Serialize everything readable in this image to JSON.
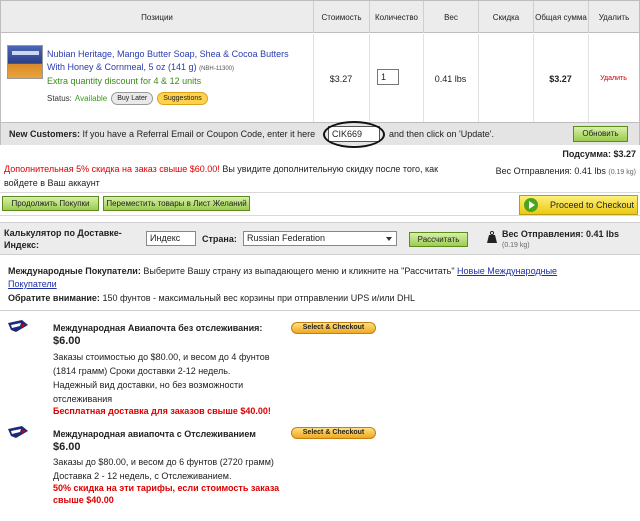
{
  "table": {
    "headers": [
      "Позиции",
      "Стоимость",
      "Количество",
      "Вес",
      "Скидка",
      "Общая сумма",
      "Удалить"
    ],
    "item": {
      "name": "Nubian Heritage, Mango Butter Soap, Shea & Cocoa Butters With Honey & Cornmeal, 5 oz (141 g)",
      "code": "(NBH-11300)",
      "discount": "Extra quantity discount for 4 & 12 units",
      "status_label": "Status:",
      "status_value": "Available",
      "buy_later": "Buy Later",
      "suggestions": "Suggestions",
      "price": "$3.27",
      "quantity": "1",
      "weight": "0.41 lbs",
      "total": "$3.27",
      "remove": "Удалить"
    }
  },
  "coupon": {
    "label_bold": "New Customers:",
    "label_text": "If you have a Referral Email or Coupon Code, enter it here",
    "value": "CIK669",
    "after_text": "and then click on 'Update'.",
    "update_button": "Обновить"
  },
  "promo": {
    "red_text": "Дополнительная 5% скидка на заказ свыше $60.00!",
    "text": "Вы увидите дополнительную скидку после того, как войдете в Ваш аккаунт"
  },
  "summary": {
    "subtotal_label": "Подсумма:",
    "subtotal_value": "$3.27",
    "shipping_weight_label": "Вес Отправления:",
    "shipping_weight_value": "0.41 lbs",
    "shipping_weight_kg": "(0.19 kg)"
  },
  "actions": {
    "continue_shopping": "Продолжить Покупки",
    "move_to_wishlist": "Переместить товары в Лист Желаний",
    "proceed_checkout": "Proceed to Checkout"
  },
  "calculator": {
    "label": "Калькулятор по Доставке- Индекс:",
    "zip_value": "Индекс",
    "country_label": "Страна:",
    "country_value": "Russian Federation",
    "calculate_button": "Рассчитать",
    "weight_label": "Вес Отправления:",
    "weight_value": "0.41 lbs",
    "weight_kg": "(0.19 kg)"
  },
  "international": {
    "bold": "Международные Покупатели:",
    "text": "Выберите Вашу страну из выпадающего меню и кликните на \"Рассчитать\"",
    "link": "Новые Международные Покупатели",
    "note_bold": "Обратите внимание:",
    "note_text": "150 фунтов - максимальный вес корзины при отправлении UPS и/или DHL"
  },
  "shipping_options": [
    {
      "title": "Международная Авиапочта без отслеживания:",
      "price": "$6.00",
      "desc_lines": [
        "Заказы стоимостью до $80.00, и весом до 4 фунтов",
        "(1814 грамм) Сроки доставки 2-12 недель.",
        "Надежный вид доставки, но без возможности",
        "отслеживания"
      ],
      "promo": "Бесплатная доставка для заказов свыше $40.00!",
      "button": "Select & Checkout"
    },
    {
      "title": "Международная авиапочта с Отслеживанием",
      "price": "$6.00",
      "desc_lines": [
        "Заказы до $80.00, и весом до 6 фунтов (2720 грамм)",
        "Доставка 2 - 12 недель, с Отслеживанием."
      ],
      "promo": "50% скидка на эти тарифы, если стоимость заказа свыше $40.00",
      "button": "Select & Checkout"
    }
  ]
}
